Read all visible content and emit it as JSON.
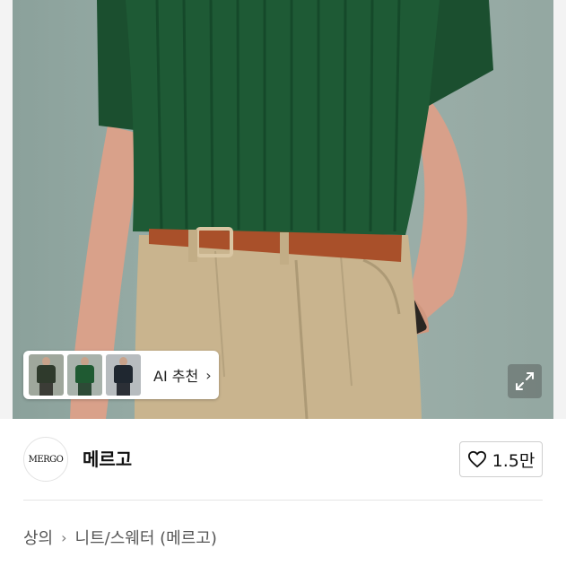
{
  "product_image": {
    "alt": "Green cable-knit short sleeve sweater with tan pleated pants and brown belt"
  },
  "ai_recommend": {
    "label": "AI 추천",
    "thumbnails": [
      {
        "name": "thumb-olive",
        "shirt_color": "#2f3a2c",
        "bg_color": "#9fa79c"
      },
      {
        "name": "thumb-green",
        "shirt_color": "#1f5a32",
        "bg_color": "#a8b2ab"
      },
      {
        "name": "thumb-navy",
        "shirt_color": "#1f2730",
        "bg_color": "#b7bcbf"
      }
    ]
  },
  "shop": {
    "logo_text": "MERGO",
    "name": "메르고",
    "likes": "1.5만"
  },
  "breadcrumb": {
    "category": "상의",
    "separator": "›",
    "subcategory": "니트/스웨터 (메르고)"
  },
  "colors": {
    "sweater": "#1e5a35",
    "pants": "#c9b48e",
    "belt": "#a9502a",
    "background": "#93a7a1"
  }
}
